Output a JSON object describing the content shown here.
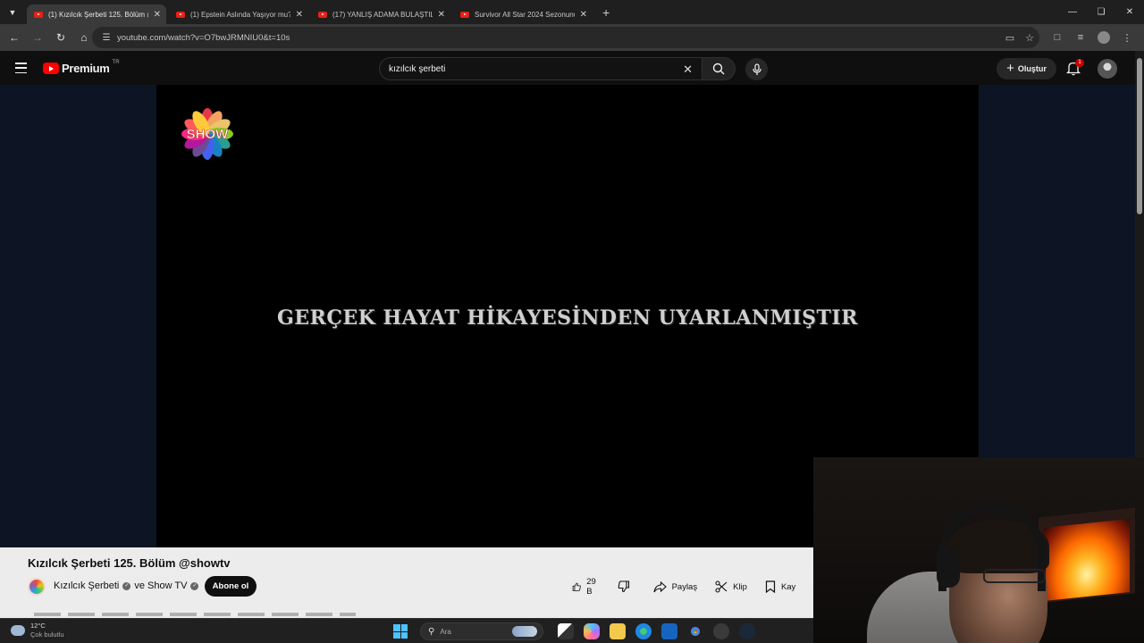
{
  "browser": {
    "tabs": [
      {
        "label": "(1) Kızılcık Şerbeti 125. Bölüm @",
        "active": true
      },
      {
        "label": "(1) Epstein Aslında Yaşıyor mu?",
        "active": false
      },
      {
        "label": "(17) YANLIŞ ADAMA BULAŞTILAR",
        "active": false
      },
      {
        "label": "Survivor All Star 2024 Sezonunu",
        "active": false
      }
    ],
    "url": "youtube.com/watch?v=O7bwJRMNIU0&t=10s"
  },
  "youtube": {
    "brand": "Premium",
    "country": "TR",
    "search_value": "kızılcık şerbeti",
    "create_label": "Oluştur",
    "notification_count": "1"
  },
  "video": {
    "caption": "GERÇEK HAYAT HİKAYESİNDEN UYARLANMIŞTIR",
    "title": "Kızılcık Şerbeti 125. Bölüm @showtv",
    "channel": "Kızılcık Şerbeti",
    "collab": "ve Show TV",
    "subscribe_label": "Abone ol",
    "likes": "29 B",
    "share_label": "Paylaş",
    "clip_label": "Klip",
    "save_label": "Kay"
  },
  "taskbar": {
    "temperature": "12°C",
    "weather": "Çok bulutlu",
    "search_placeholder": "Ara"
  },
  "colors": {
    "youtube_red": "#ff0000",
    "subscribe_bg": "#0f0f0f",
    "windows_accent": "#4cc2ff"
  }
}
